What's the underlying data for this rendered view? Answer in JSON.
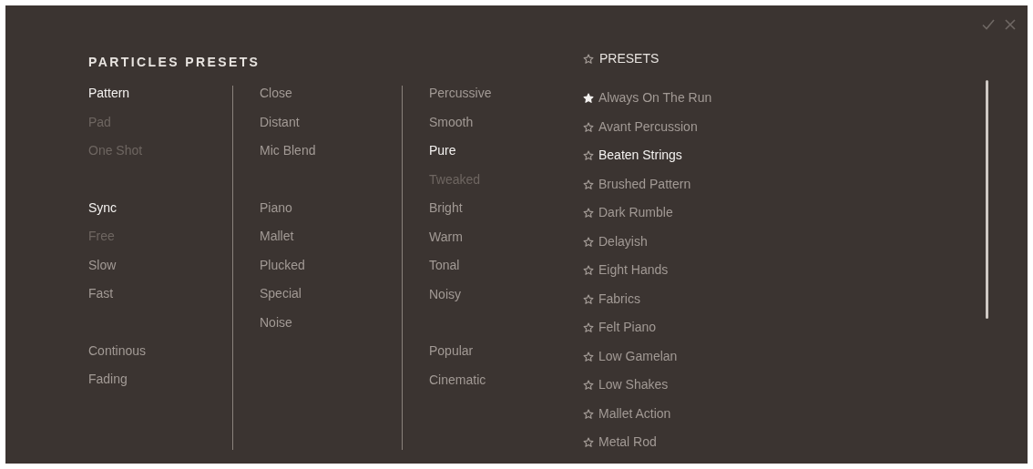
{
  "title": "PARTICLES PRESETS",
  "columns": [
    {
      "groups": [
        [
          {
            "label": "Pattern",
            "selected": true,
            "disabled": false
          },
          {
            "label": "Pad",
            "selected": false,
            "disabled": true
          },
          {
            "label": "One Shot",
            "selected": false,
            "disabled": true
          }
        ],
        [
          {
            "label": "Sync",
            "selected": true,
            "disabled": false
          },
          {
            "label": "Free",
            "selected": false,
            "disabled": true
          },
          {
            "label": "Slow",
            "selected": false,
            "disabled": false
          },
          {
            "label": "Fast",
            "selected": false,
            "disabled": false
          }
        ],
        [
          {
            "label": "Continous",
            "selected": false,
            "disabled": false
          },
          {
            "label": "Fading",
            "selected": false,
            "disabled": false
          }
        ]
      ]
    },
    {
      "groups": [
        [
          {
            "label": "Close",
            "selected": false,
            "disabled": false
          },
          {
            "label": "Distant",
            "selected": false,
            "disabled": false
          },
          {
            "label": "Mic Blend",
            "selected": false,
            "disabled": false
          }
        ],
        [
          {
            "label": "Piano",
            "selected": false,
            "disabled": false
          },
          {
            "label": "Mallet",
            "selected": false,
            "disabled": false
          },
          {
            "label": "Plucked",
            "selected": false,
            "disabled": false
          },
          {
            "label": "Special",
            "selected": false,
            "disabled": false
          },
          {
            "label": "Noise",
            "selected": false,
            "disabled": false
          }
        ]
      ]
    },
    {
      "groups": [
        [
          {
            "label": "Percussive",
            "selected": false,
            "disabled": false
          },
          {
            "label": "Smooth",
            "selected": false,
            "disabled": false
          },
          {
            "label": "Pure",
            "selected": true,
            "disabled": false
          },
          {
            "label": "Tweaked",
            "selected": false,
            "disabled": true
          },
          {
            "label": "Bright",
            "selected": false,
            "disabled": false
          },
          {
            "label": "Warm",
            "selected": false,
            "disabled": false
          },
          {
            "label": "Tonal",
            "selected": false,
            "disabled": false
          },
          {
            "label": "Noisy",
            "selected": false,
            "disabled": false
          }
        ],
        [
          {
            "label": "Popular",
            "selected": false,
            "disabled": false
          },
          {
            "label": "Cinematic",
            "selected": false,
            "disabled": false
          }
        ]
      ]
    }
  ],
  "presets": {
    "header": "PRESETS",
    "items": [
      {
        "label": "Always On The Run",
        "starred": true,
        "selected": false
      },
      {
        "label": "Avant Percussion",
        "starred": false,
        "selected": false
      },
      {
        "label": "Beaten Strings",
        "starred": false,
        "selected": true
      },
      {
        "label": "Brushed Pattern",
        "starred": false,
        "selected": false
      },
      {
        "label": "Dark Rumble",
        "starred": false,
        "selected": false
      },
      {
        "label": "Delayish",
        "starred": false,
        "selected": false
      },
      {
        "label": "Eight Hands",
        "starred": false,
        "selected": false
      },
      {
        "label": "Fabrics",
        "starred": false,
        "selected": false
      },
      {
        "label": "Felt Piano",
        "starred": false,
        "selected": false
      },
      {
        "label": "Low Gamelan",
        "starred": false,
        "selected": false
      },
      {
        "label": "Low Shakes",
        "starred": false,
        "selected": false
      },
      {
        "label": "Mallet Action",
        "starred": false,
        "selected": false
      },
      {
        "label": "Metal Rod",
        "starred": false,
        "selected": false
      }
    ]
  }
}
